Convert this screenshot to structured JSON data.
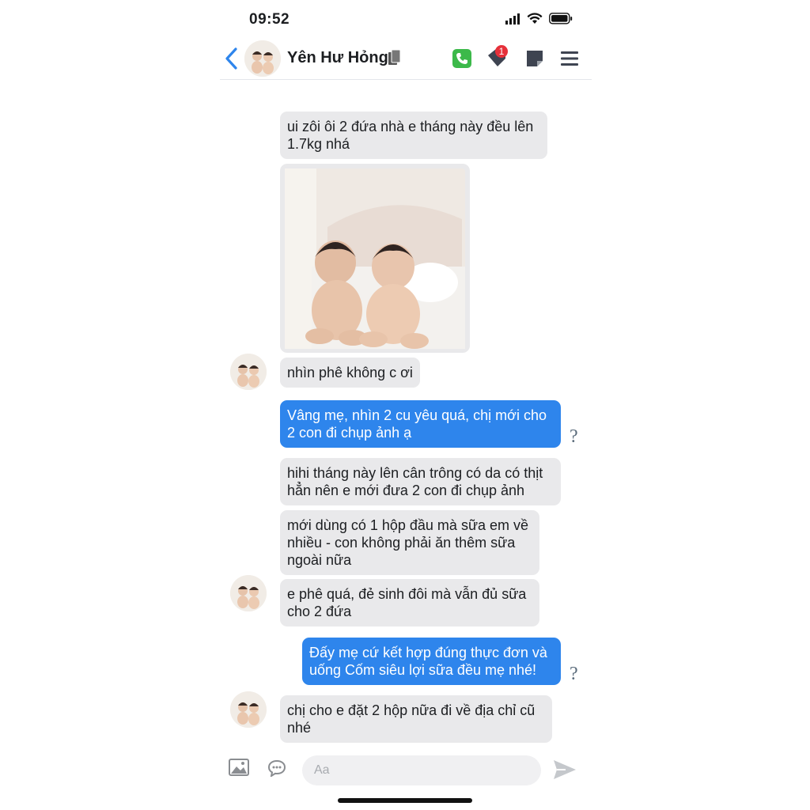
{
  "status_bar": {
    "time": "09:52"
  },
  "header": {
    "contact_name": "Yên Hư Hỏng",
    "notification_count": "1"
  },
  "messages": [
    {
      "side": "in",
      "text": "ui zôi ôi 2 đứa nhà e tháng này đều lên\n1.7kg nhá"
    },
    {
      "side": "in",
      "type": "photo"
    },
    {
      "side": "in",
      "text": "nhìn phê không c ơi"
    },
    {
      "side": "out",
      "text": "Vâng mẹ, nhìn 2 cu yêu quá, chị mới cho\n2 con đi chụp ảnh ạ",
      "status": "?"
    },
    {
      "side": "in",
      "text": "hihi tháng này lên cân trông có da có thịt\nhẳn nên e mới đưa 2 con đi chụp ảnh"
    },
    {
      "side": "in",
      "text": "mới dùng có 1 hộp đầu mà sữa em về\nnhiều - con không phải ăn thêm sữa\nngoài nữa"
    },
    {
      "side": "in",
      "text": "e phê quá, đẻ sinh đôi mà vẫn đủ sữa\ncho 2 đứa"
    },
    {
      "side": "out",
      "text": "Đấy mẹ cứ kết hợp đúng thực đơn và\nuống Cốm siêu lợi sữa đều mẹ nhé!",
      "status": "?"
    },
    {
      "side": "in",
      "text": "chị cho e đặt 2 hộp nữa đi về địa chỉ cũ\nnhé"
    }
  ],
  "composer": {
    "placeholder": "Aa"
  },
  "colors": {
    "accent": "#2e85ec",
    "call_green": "#3cb94a",
    "badge_red": "#e6303a"
  },
  "icons": [
    "back-chevron-icon",
    "copy-icon",
    "phone-icon",
    "tag-icon",
    "note-icon",
    "menu-icon",
    "image-icon",
    "sticker-icon",
    "send-icon"
  ]
}
